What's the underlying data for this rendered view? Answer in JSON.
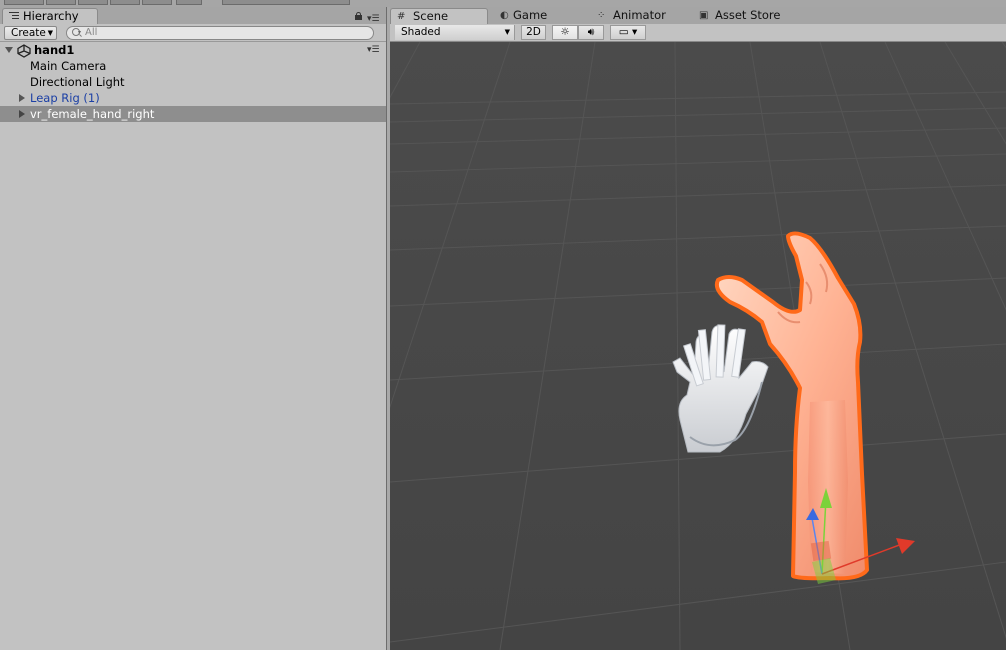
{
  "hierarchy": {
    "tab_label": "Hierarchy",
    "create_label": "Create",
    "search_placeholder": "All",
    "scene_name": "hand1",
    "items": [
      {
        "label": "Main Camera",
        "expandable": false,
        "prefab": false,
        "selected": false
      },
      {
        "label": "Directional Light",
        "expandable": false,
        "prefab": false,
        "selected": false
      },
      {
        "label": "Leap Rig (1)",
        "expandable": true,
        "prefab": true,
        "selected": false
      },
      {
        "label": "vr_female_hand_right",
        "expandable": true,
        "prefab": false,
        "selected": true
      }
    ]
  },
  "scene_view": {
    "tabs": [
      {
        "label": "Scene",
        "icon": "grid-icon",
        "active": true
      },
      {
        "label": "Game",
        "icon": "pacman-icon",
        "active": false
      },
      {
        "label": "Animator",
        "icon": "animator-icon",
        "active": false
      },
      {
        "label": "Asset Store",
        "icon": "store-icon",
        "active": false
      }
    ],
    "draw_mode": "Shaded",
    "mode_2d_label": "2D",
    "lighting_icon": "sun-icon",
    "audio_icon": "speaker-icon",
    "effects_icon": "image-icon"
  },
  "colors": {
    "selection_outline": "#ff6a1a",
    "gizmo_x": "#e03a2a",
    "gizmo_y": "#7cd23a",
    "gizmo_z": "#3a6ae0",
    "prefab_text": "#1b3fa5"
  }
}
